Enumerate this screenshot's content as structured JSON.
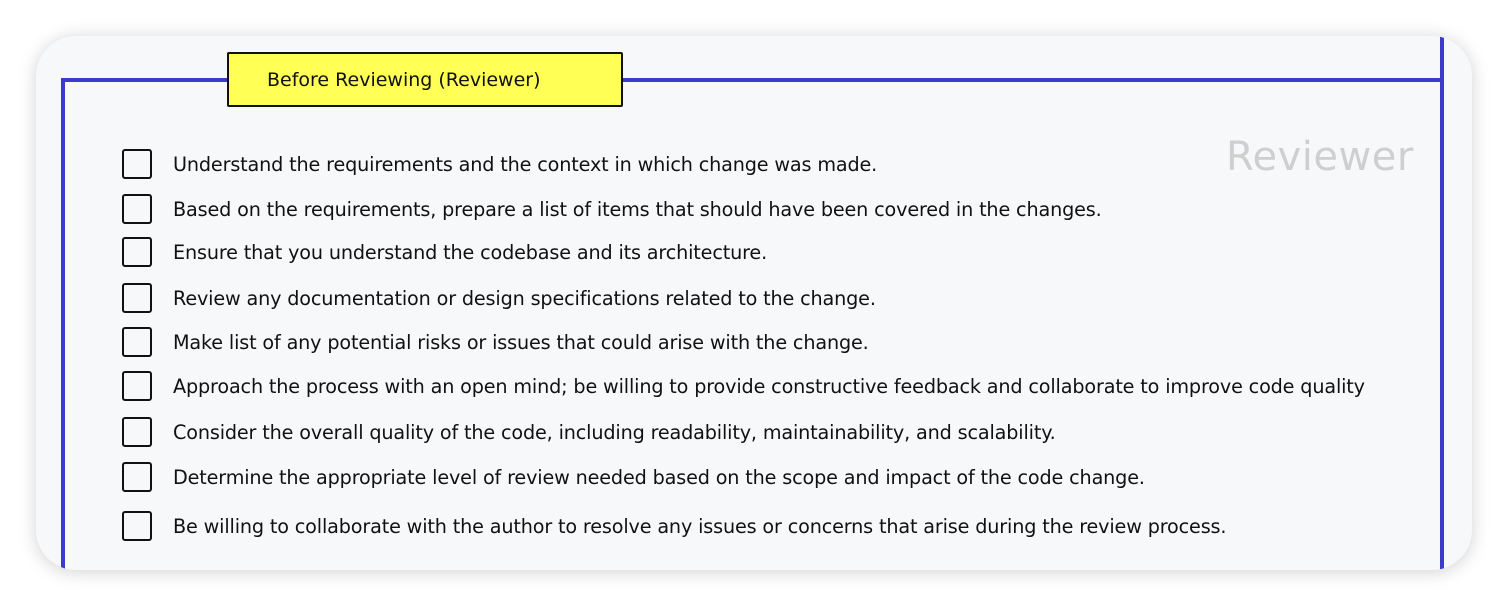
{
  "section": {
    "title": "Before Reviewing (Reviewer)",
    "role": "Reviewer"
  },
  "colors": {
    "frame": "#3b3bcc",
    "title_background": "#ffff55",
    "watermark": "#cfcfcf"
  },
  "checklist": {
    "items": [
      {
        "label": "Understand the requirements and the context in which change was made.",
        "checked": false
      },
      {
        "label": "Based on the requirements, prepare a list of items that should have been covered in the changes.",
        "checked": false
      },
      {
        "label": "Ensure that you understand the codebase and its architecture.",
        "checked": false
      },
      {
        "label": "Review any documentation or design specifications related to the change.",
        "checked": false
      },
      {
        "label": "Make list of any potential risks or issues that could arise with the change.",
        "checked": false
      },
      {
        "label": "Approach the process with an open mind; be willing to provide constructive feedback and collaborate to improve code quality",
        "checked": false
      },
      {
        "label": "Consider the overall quality of the code, including readability, maintainability, and scalability.",
        "checked": false
      },
      {
        "label": "Determine the appropriate level of review needed based on the scope and impact of the code change.",
        "checked": false
      },
      {
        "label": "Be willing to collaborate with the author to resolve any issues or concerns that arise during the review process.",
        "checked": false
      }
    ]
  }
}
